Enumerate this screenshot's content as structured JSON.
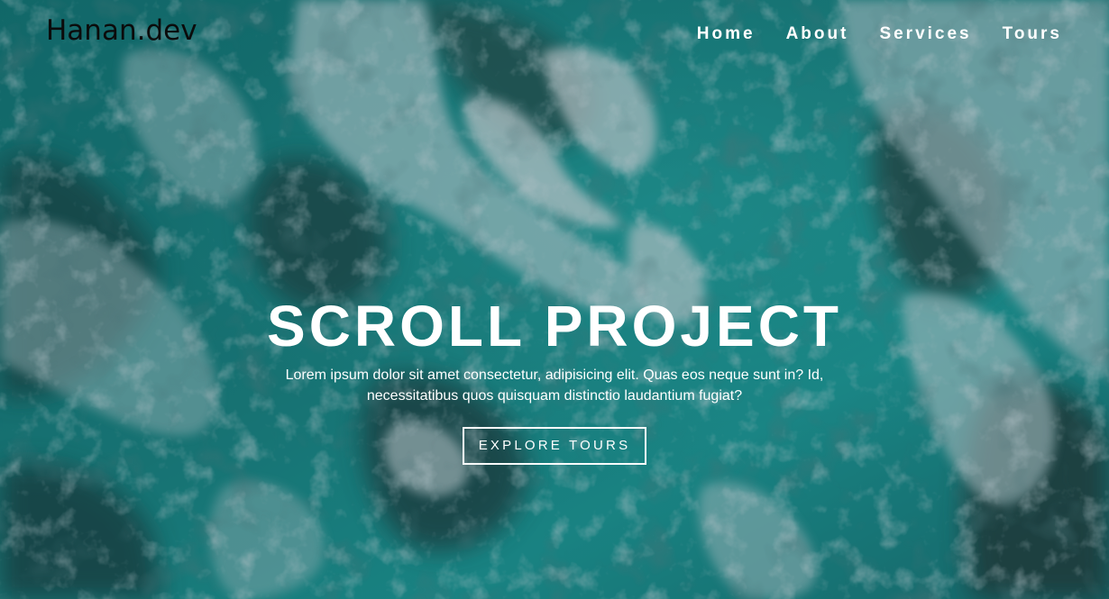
{
  "navbar": {
    "logo": "Hanan.dev",
    "links": [
      {
        "label": "Home"
      },
      {
        "label": "About"
      },
      {
        "label": "Services"
      },
      {
        "label": "Tours"
      }
    ]
  },
  "banner": {
    "title": "SCROLL PROJECT",
    "text": "Lorem ipsum dolor sit amet consectetur, adipisicing elit. Quas eos neque sunt in? Id, necessitatibus quos quisquam distinctio laudantium fugiat?",
    "button_label": "EXPLORE TOURS"
  },
  "colors": {
    "text": "#ffffff",
    "logo": "#0b0b0b",
    "sea_deep": "#17706f",
    "sea_light": "#23b3ad",
    "foam": "#cfe9ea"
  }
}
